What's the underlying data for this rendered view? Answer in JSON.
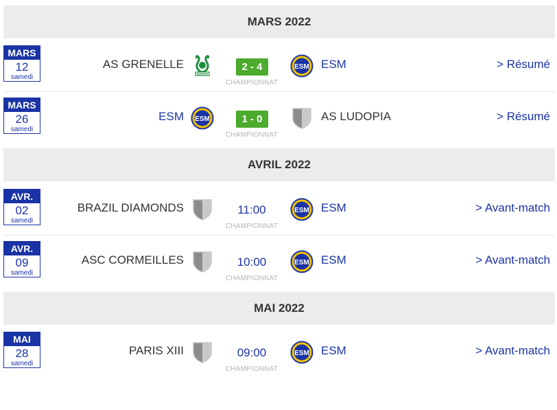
{
  "colors": {
    "brand": "#1a33a6",
    "score_bg": "#4caa2c",
    "month_bg": "#ececec",
    "muted": "#b3b3b3"
  },
  "months": [
    {
      "label": "MARS 2022"
    },
    {
      "label": "AVRIL 2022"
    },
    {
      "label": "MAI 2022"
    }
  ],
  "matches": [
    {
      "month": "MARS",
      "day": "12",
      "weekday": "samedi",
      "home": "AS GRENELLE",
      "home_logo": "grenelle-logo",
      "away": "ESM",
      "away_logo": "esm-logo",
      "result": "2 - 4",
      "competition": "CHAMPIONNAT",
      "link": "> Résumé"
    },
    {
      "month": "MARS",
      "day": "26",
      "weekday": "samedi",
      "home": "ESM",
      "home_logo": "esm-logo",
      "away": "AS LUDOPIA",
      "away_logo": "shield-icon",
      "result": "1 - 0",
      "competition": "CHAMPIONNAT",
      "link": "> Résumé"
    },
    {
      "month": "AVR.",
      "day": "02",
      "weekday": "samedi",
      "home": "BRAZIL DIAMONDS",
      "home_logo": "shield-icon",
      "away": "ESM",
      "away_logo": "esm-logo",
      "time": "11:00",
      "competition": "CHAMPIONNAT",
      "link": "> Avant-match"
    },
    {
      "month": "AVR.",
      "day": "09",
      "weekday": "samedi",
      "home": "ASC CORMEILLES",
      "home_logo": "shield-icon",
      "away": "ESM",
      "away_logo": "esm-logo",
      "time": "10:00",
      "competition": "CHAMPIONNAT",
      "link": "> Avant-match"
    },
    {
      "month": "MAI",
      "day": "28",
      "weekday": "samedi",
      "home": "PARIS XIII",
      "home_logo": "shield-icon",
      "away": "ESM",
      "away_logo": "esm-logo",
      "time": "09:00",
      "competition": "CHAMPIONNAT",
      "link": "> Avant-match"
    }
  ]
}
